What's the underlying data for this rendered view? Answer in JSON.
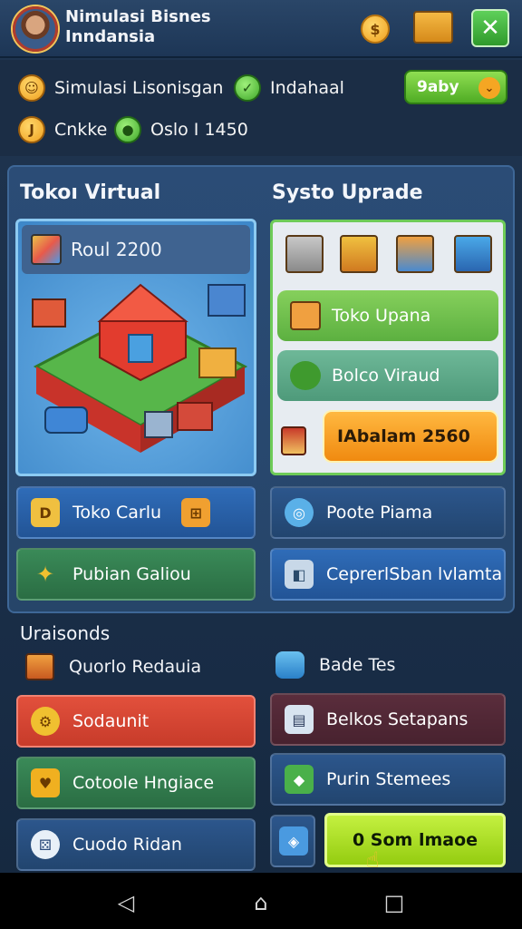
{
  "header": {
    "title_line1": "Nimulasi Bisnes",
    "title_line2": "Inndansia",
    "coin_symbol": "$"
  },
  "stats": [
    {
      "label": "Simulasi Lisonisgan",
      "icon": "gold-coin-icon"
    },
    {
      "label": "Indahaal",
      "icon": "green-leaf-icon"
    },
    {
      "label": "Cnkke",
      "icon": "gold-coin-icon"
    },
    {
      "label": "Oslo I 1450",
      "icon": "green-coin-icon"
    }
  ],
  "buy_button": {
    "label": "9aby"
  },
  "sections": {
    "shop_title": "Tokoı Virtual",
    "upgrade_title": "Systo Uprade",
    "bottom_title": "Uraisonds"
  },
  "shop": {
    "label": "Roul 2200"
  },
  "upgrades": [
    {
      "label": "Toko Upana",
      "color": "#6cc24a"
    },
    {
      "label": "Bolco Viraud",
      "color": "#5bab8a"
    },
    {
      "label": "IAbalam 2560",
      "color": "#f5a020"
    }
  ],
  "actions": [
    {
      "label": "Toko Carlu",
      "style": "blue"
    },
    {
      "label": "Poote Piama",
      "style": "navy"
    },
    {
      "label": "Pubian Galiou",
      "style": "green"
    },
    {
      "label": "CeprerlSban lvlamta",
      "style": "blue"
    }
  ],
  "bottom": {
    "items": [
      {
        "label": "Quorlo Redauia"
      },
      {
        "label": "Bade Tes"
      }
    ],
    "buttons": [
      {
        "label": "Sodaunit",
        "style": "red"
      },
      {
        "label": "Belkos Setapans",
        "style": "maroon"
      },
      {
        "label": "Cotoole Hngiace",
        "style": "green"
      },
      {
        "label": "Purin Stemees",
        "style": "navy"
      },
      {
        "label": "Cuodo Ridan",
        "style": "navy"
      },
      {
        "label": "0 Som lmaoe",
        "style": "lime"
      }
    ]
  }
}
